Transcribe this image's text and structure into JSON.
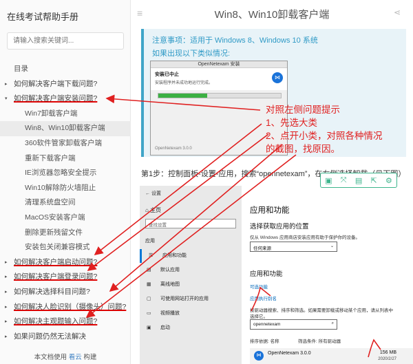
{
  "sidebar": {
    "title": "在线考试帮助手册",
    "search_placeholder": "请输入搜索关键词...",
    "toc_label": "目录",
    "items": [
      {
        "label": "如何解决客户端下载问题?",
        "kind": "head",
        "arrow": "▸"
      },
      {
        "label": "如何解决客户端安装问题?",
        "kind": "head",
        "arrow": "▾"
      },
      {
        "label": "Win7卸载客户端",
        "kind": "child"
      },
      {
        "label": "Win8、Win10卸载客户端",
        "kind": "child",
        "active": true
      },
      {
        "label": "360软件管家卸载客户端",
        "kind": "child"
      },
      {
        "label": "重新下载客户端",
        "kind": "child"
      },
      {
        "label": "IE浏览器忽略安全提示",
        "kind": "child"
      },
      {
        "label": "Win10解除防火墙阻止",
        "kind": "child"
      },
      {
        "label": "清理系统盘空间",
        "kind": "child"
      },
      {
        "label": "MacOS安装客户端",
        "kind": "child"
      },
      {
        "label": "删除更新残留文件",
        "kind": "child"
      },
      {
        "label": "安装包关闭兼容模式",
        "kind": "child"
      },
      {
        "label": "如何解决客户端启动问题?",
        "kind": "head",
        "arrow": "▸"
      },
      {
        "label": "如何解决客户端登录问题?",
        "kind": "head",
        "arrow": "▸"
      },
      {
        "label": "如何解决选择科目问题?",
        "kind": "head",
        "arrow": "▸"
      },
      {
        "label": "如何解决人脸识别（摄像头）问题?",
        "kind": "head",
        "arrow": "▸"
      },
      {
        "label": "如何解决主观题输入问题?",
        "kind": "head",
        "arrow": "▸"
      },
      {
        "label": "如果问题仍然无法解决",
        "kind": "head",
        "arrow": "▸"
      }
    ],
    "footer_prefix": "本文档使用",
    "footer_link": "看云",
    "footer_suffix": "构建"
  },
  "header": {
    "title": "Win8、Win10卸载客户端"
  },
  "notice": {
    "line1": "注意事项：适用于 Windows 8、Windows 10 系统",
    "line2": "如果出现以下类似情况:"
  },
  "dialog": {
    "title": "OpenNetexam 安装",
    "heading": "安装已中止",
    "subheading": "安装程序并未成功地运行完成。",
    "progress": 0.4,
    "footer": "OpenNetexam 3.0.0"
  },
  "callout": {
    "line1": "对照左侧问题提示",
    "line2": "1、先选大类",
    "line3": "2、点开小类，对照各种情况",
    "line4": "的截图，找原因。"
  },
  "step1": {
    "text": "第1步：控制面板-设置-应用，搜索“opennetexam”，在右侧选择卸载（见下图）"
  },
  "settings": {
    "back": "← 设置",
    "home": "主页",
    "search_placeholder": "查找设置",
    "category": "应用",
    "nav": [
      {
        "icon": "☰",
        "label": "应用和功能",
        "selected": true
      },
      {
        "icon": "▤",
        "label": "默认应用"
      },
      {
        "icon": "▦",
        "label": "离线地图"
      },
      {
        "icon": "▢",
        "label": "可使用网站打开的应用"
      },
      {
        "icon": "▭",
        "label": "视频播放"
      },
      {
        "icon": "▣",
        "label": "启动"
      }
    ],
    "main_title": "应用和功能",
    "section1_title": "选择获取应用的位置",
    "section1_desc": "仅从 Windows 应用商店安装应用有助于保护你的设备。",
    "source_select": "任何来源",
    "section2_title": "应用和功能",
    "optional_link": "可选功能",
    "alias_link": "应用执行别名",
    "section2_desc1": "按驱动器搜索、排序和筛选。如果需要卸载或移动某个应用，请从列表中",
    "section2_desc2": "选择它。",
    "search_value": "opennetexam",
    "sort_label": "排序依据: 名称",
    "filter_label": "筛选条件: 所有驱动器",
    "app_name": "OpenNetexam 3.0.0",
    "app_size": "156 MB",
    "app_date": "2020/2/27"
  },
  "colors": {
    "accent": "#3fa5c8",
    "annotation": "#e02020",
    "progress": "#3cb043",
    "toolbar": "#3cb48c"
  }
}
